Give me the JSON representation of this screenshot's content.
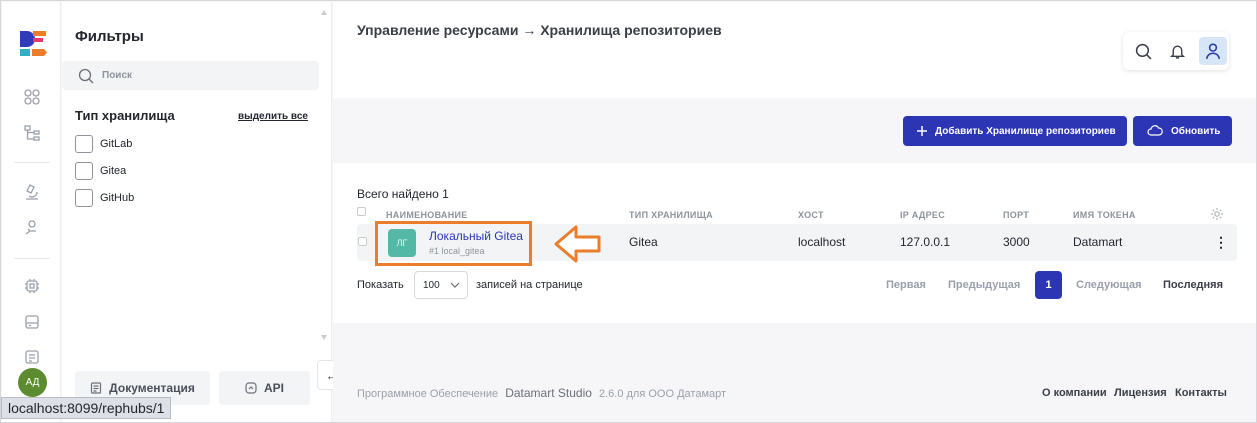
{
  "filters": {
    "title": "Фильтры",
    "search_placeholder": "Поиск",
    "storage_type_label": "Тип хранилища",
    "select_all": "выделить все",
    "options": [
      "GitLab",
      "Gitea",
      "GitHub"
    ],
    "docs_button": "Документация",
    "api_button": "API",
    "collapse_glyph": "←"
  },
  "user": {
    "initials": "АД"
  },
  "header": {
    "breadcrumb": "Управление ресурсами → Хранилища репозиториев"
  },
  "actions": {
    "add_label": "Добавить Хранилище репозиториев",
    "refresh_label": "Обновить"
  },
  "table": {
    "total": "Всего найдено 1",
    "columns": [
      "НАИМЕНОВАНИЕ",
      "ТИП ХРАНИЛИЩА",
      "ХОСТ",
      "IP АДРЕС",
      "ПОРТ",
      "ИМЯ ТОКЕНА"
    ],
    "rows": [
      {
        "initials": "ЛГ",
        "name": "Локальный Gitea",
        "sub": "#1 local_gitea",
        "type": "Gitea",
        "host": "localhost",
        "ip": "127.0.0.1",
        "port": "3000",
        "token": "Datamart",
        "menu": "⋮"
      }
    ]
  },
  "pagination": {
    "show_label": "Показать",
    "page_size": "100",
    "per_page_label": "записей на странице",
    "first": "Первая",
    "prev": "Предыдущая",
    "current": "1",
    "next": "Следующая",
    "last": "Последняя"
  },
  "footer": {
    "prefix": "Программное Обеспечение",
    "product": "Datamart Studio",
    "version": "2.6.0 для ООО Датамарт",
    "links": [
      "О компании",
      "Лицензия",
      "Контакты"
    ]
  },
  "status_url": "localhost:8099/rephubs/1",
  "colors": {
    "accent": "#2c36b5",
    "highlight": "#ec7d2b",
    "thumb": "#53b8a6",
    "avatar": "#5d8b2f"
  }
}
